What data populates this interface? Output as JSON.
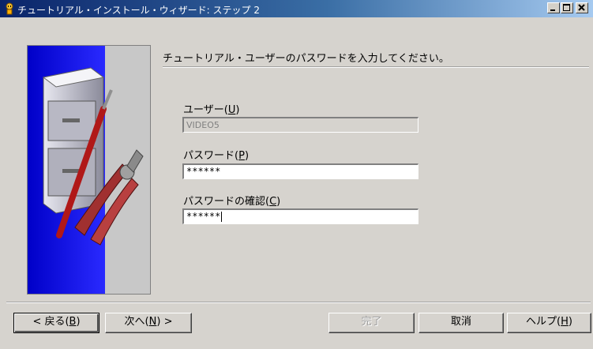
{
  "window": {
    "title": "チュートリアル・インストール・ウィザード: ステップ 2",
    "minimize_label": "_",
    "maximize_label": "□",
    "close_label": "×"
  },
  "main": {
    "heading": "チュートリアル・ユーザーのパスワードを入力してください。",
    "user": {
      "label": "ユーザー",
      "mnemonic": "U",
      "value": "VIDEO5",
      "disabled": true
    },
    "password": {
      "label": "パスワード",
      "mnemonic": "P",
      "value": "******"
    },
    "confirm": {
      "label": "パスワードの確認",
      "mnemonic": "C",
      "value": "******"
    }
  },
  "buttons": {
    "back": {
      "label": "< 戻る",
      "mnemonic": "B"
    },
    "next": {
      "label": "次へ",
      "mnemonic": "N",
      "suffix": " >"
    },
    "finish": {
      "label": "完了",
      "enabled": false
    },
    "cancel": {
      "label": "取消"
    },
    "help": {
      "label": "ヘルプ",
      "mnemonic": "H"
    }
  },
  "icons": {
    "title_icon": "wizard-icon",
    "image": "file-cabinet-tools-illustration"
  },
  "colors": {
    "titlebar_start": "#0a246a",
    "titlebar_end": "#a6caf0",
    "dialog_bg": "#d6d3ce",
    "image_blue": "#1a1aff"
  }
}
